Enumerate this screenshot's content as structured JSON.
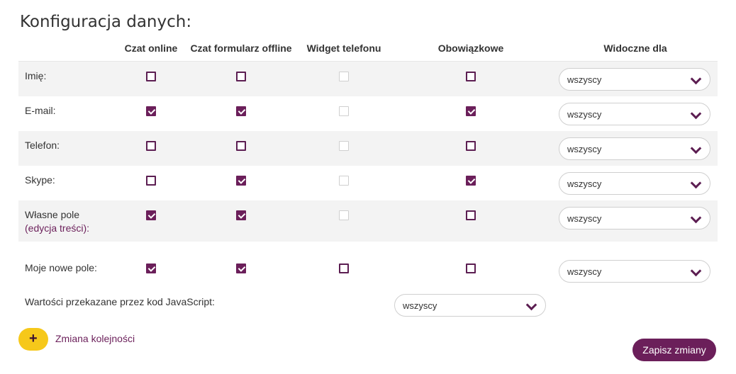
{
  "title": "Konfiguracja danych:",
  "columns": {
    "chat_online": "Czat online",
    "offline_form": "Czat formularz offline",
    "phone_widget": "Widget telefonu",
    "required": "Obowiązkowe",
    "visible_for": "Widoczne dla"
  },
  "rows": [
    {
      "label": "Imię:",
      "chat_online": false,
      "offline_form": false,
      "phone_widget": "disabled",
      "required": false,
      "visible_for": "wszyscy"
    },
    {
      "label": "E-mail:",
      "chat_online": true,
      "offline_form": true,
      "phone_widget": "disabled",
      "required": true,
      "visible_for": "wszyscy"
    },
    {
      "label": "Telefon:",
      "chat_online": false,
      "offline_form": false,
      "phone_widget": "disabled",
      "required": false,
      "visible_for": "wszyscy"
    },
    {
      "label": "Skype:",
      "chat_online": false,
      "offline_form": true,
      "phone_widget": "disabled",
      "required": true,
      "visible_for": "wszyscy"
    },
    {
      "label": "Własne pole",
      "link": "(edycja treści):",
      "chat_online": true,
      "offline_form": true,
      "phone_widget": "disabled",
      "required": false,
      "visible_for": "wszyscy"
    },
    {
      "label": "Moje nowe pole:",
      "chat_online": true,
      "offline_form": true,
      "phone_widget": false,
      "required": false,
      "visible_for": "wszyscy"
    }
  ],
  "js_values": {
    "label": "Wartości przekazane przez kod JavaScript:",
    "value": "wszyscy"
  },
  "reorder": {
    "icon": "plus-icon",
    "label": "Zmiana kolejności"
  },
  "save_button": "Zapisz zmiany",
  "colors": {
    "accent": "#6b1f5a",
    "add_button": "#f6c81a",
    "row_shade": "#f3f3f3"
  }
}
